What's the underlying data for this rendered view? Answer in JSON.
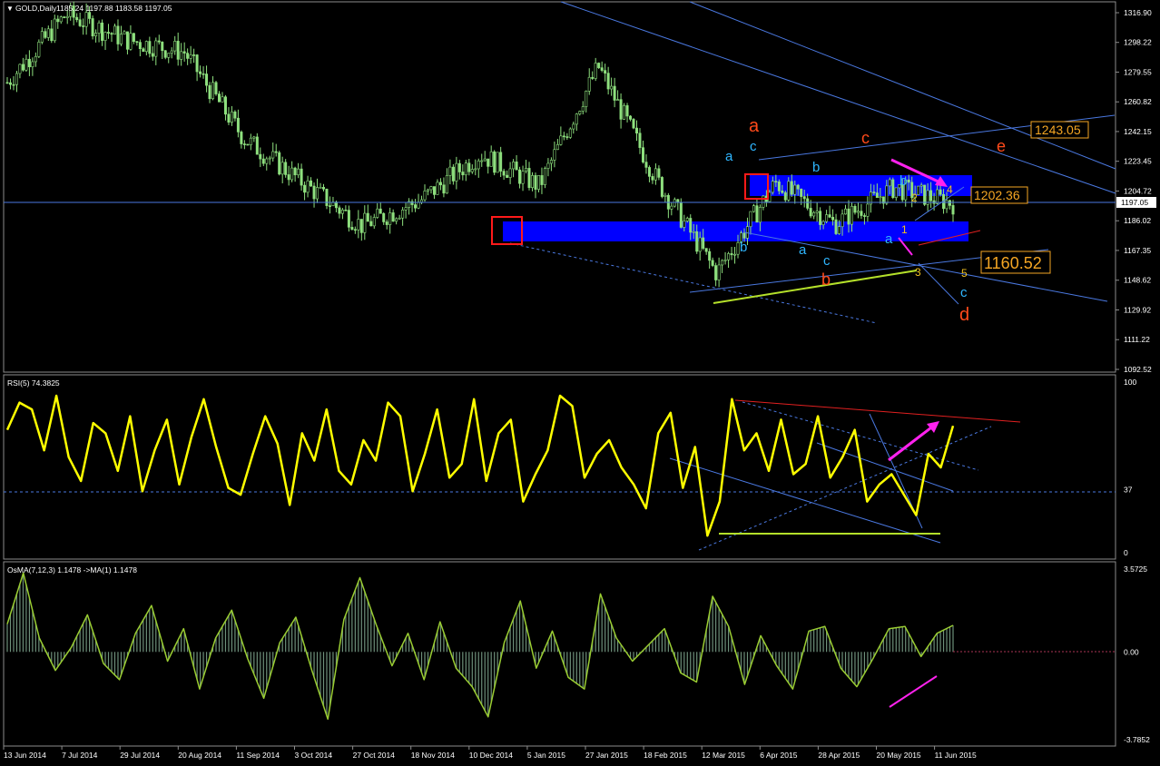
{
  "colors": {
    "background": "#000000",
    "panel_border": "#8c8c8c",
    "candle": "#8ee07e",
    "rsi_line": "#ffff00",
    "osma_line": "#9acd32",
    "osma_hist": "#6d8f7a",
    "channel": "#4a78e0",
    "zone": "#0000ff",
    "red_box": "#ff1a1a",
    "wave_orange": "#ff4a1a",
    "wave_cyan": "#2fb6ff",
    "wave_yellow": "#f0c020",
    "magenta": "#ff22ee",
    "green_line": "#b4e02a",
    "trend_red": "#e02020",
    "price_tag": "#f5a623"
  },
  "header": {
    "symbol": "GOLD,Daily",
    "ohlc": "1185.24 1197.88 1183.58 1197.05",
    "rsi_label": "RSI(5) 74.3825",
    "osma_label": "OsMA(7,12,3) 1.1478  ->MA(1) 1.1478"
  },
  "price_axis": [
    "1316.90",
    "1298.22",
    "1279.55",
    "1260.82",
    "1242.15",
    "1223.45",
    "1204.72",
    "1186.02",
    "1167.35",
    "1148.62",
    "1129.92",
    "1111.22",
    "1092.52"
  ],
  "current_price": "1197.05",
  "price_tags": [
    "1243.05",
    "1202.36",
    "1160.52"
  ],
  "rsi_axis": [
    "100",
    "37",
    "0"
  ],
  "osma_axis": [
    "3.5725",
    "0.00",
    "-3.7852"
  ],
  "date_axis": [
    "13 Jun 2014",
    "7 Jul 2014",
    "29 Jul 2014",
    "20 Aug 2014",
    "11 Sep 2014",
    "3 Oct 2014",
    "27 Oct 2014",
    "18 Nov 2014",
    "10 Dec 2014",
    "5 Jan 2015",
    "27 Jan 2015",
    "18 Feb 2015",
    "12 Mar 2015",
    "6 Apr 2015",
    "28 Apr 2015",
    "20 May 2015",
    "11 Jun 2015"
  ],
  "wave_labels": {
    "orange": [
      "a",
      "c",
      "e",
      "b",
      "d"
    ],
    "cyan": [
      "a",
      "c",
      "b",
      "a",
      "c",
      "b",
      "a",
      "b",
      "c"
    ],
    "yellow": [
      "4",
      "2",
      "1",
      "3",
      "5"
    ]
  },
  "chart_data": {
    "type": "candlestick",
    "title": "GOLD,Daily",
    "x": [
      "13 Jun 2014",
      "7 Jul 2014",
      "29 Jul 2014",
      "20 Aug 2014",
      "11 Sep 2014",
      "3 Oct 2014",
      "27 Oct 2014",
      "18 Nov 2014",
      "10 Dec 2014",
      "5 Jan 2015",
      "27 Jan 2015",
      "18 Feb 2015",
      "12 Mar 2015",
      "6 Apr 2015",
      "28 Apr 2015",
      "20 May 2015",
      "11 Jun 2015"
    ],
    "close": [
      1273,
      1316,
      1300,
      1292,
      1238,
      1210,
      1183,
      1199,
      1228,
      1208,
      1283,
      1211,
      1153,
      1210,
      1184,
      1207,
      1197
    ],
    "ylim": [
      1092.52,
      1316.9
    ],
    "series": [
      {
        "name": "RSI(5)",
        "last": 74.3825,
        "ylim": [
          0,
          100
        ]
      },
      {
        "name": "OsMA(7,12,3)",
        "last": 1.1478,
        "ylim": [
          -3.7852,
          3.5725
        ]
      }
    ]
  }
}
